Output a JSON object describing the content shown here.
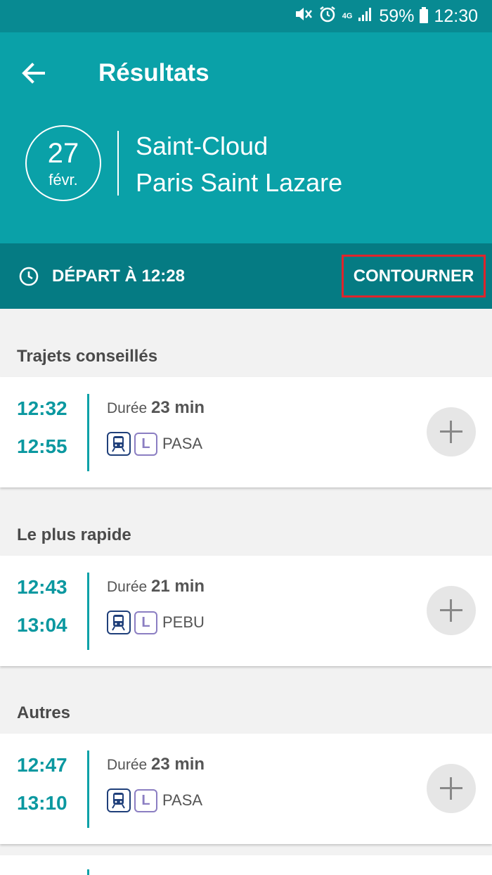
{
  "status_bar": {
    "network": "4G",
    "battery": "59%",
    "time": "12:30"
  },
  "header": {
    "title": "Résultats",
    "date_day": "27",
    "date_month": "févr.",
    "from": "Saint-Cloud",
    "to": "Paris Saint Lazare"
  },
  "departure_bar": {
    "label": "DÉPART À 12:28",
    "bypass_label": "CONTOURNER"
  },
  "sections": [
    {
      "title": "Trajets conseillés",
      "journey": {
        "departure": "12:32",
        "arrival": "12:55",
        "duration_label": "Durée",
        "duration": "23 min",
        "line": "L",
        "mission": "PASA"
      }
    },
    {
      "title": "Le plus rapide",
      "journey": {
        "departure": "12:43",
        "arrival": "13:04",
        "duration_label": "Durée",
        "duration": "21 min",
        "line": "L",
        "mission": "PEBU"
      }
    },
    {
      "title": "Autres",
      "journey": {
        "departure": "12:47",
        "arrival": "13:10",
        "duration_label": "Durée",
        "duration": "23 min",
        "line": "L",
        "mission": "PASA"
      }
    }
  ],
  "colors": {
    "status_bar": "#088a92",
    "header": "#0aa1a8",
    "departure_bar": "#057b83",
    "time_text": "#0b98a0",
    "highlight_box": "#e0242b",
    "train_icon": "#1f3f7a",
    "line_badge": "#8b7ec2"
  },
  "icons": [
    "mute-icon",
    "alarm-icon",
    "signal-icon",
    "battery-icon",
    "back-arrow-icon",
    "clock-icon",
    "train-icon",
    "add-icon"
  ]
}
